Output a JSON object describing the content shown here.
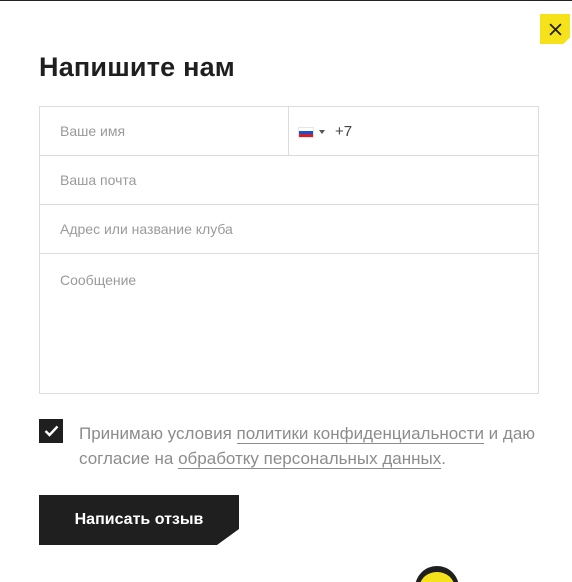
{
  "dialog": {
    "title": "Напишите нам",
    "close_icon": "close-icon"
  },
  "form": {
    "name_placeholder": "Ваше имя",
    "phone": {
      "country_flag": "russia-flag-icon",
      "country_flag_colors": [
        "#ffffff",
        "#1f4fcf",
        "#d0202a"
      ],
      "value": "+7"
    },
    "email_placeholder": "Ваша почта",
    "address_placeholder": "Адрес или название клуба",
    "message_placeholder": "Сообщение"
  },
  "consent": {
    "checked": true,
    "text_before": "Принимаю условия ",
    "privacy_link": "политики конфиденциальности",
    "text_middle": " и даю согласие на ",
    "data_link": "обработку персональных данных",
    "text_after": "."
  },
  "submit": {
    "label": "Написать отзыв"
  },
  "colors": {
    "accent": "#f5e21a",
    "dark": "#1f1f1f",
    "border": "#dcdcdc",
    "muted_text": "#8c8c8c"
  }
}
